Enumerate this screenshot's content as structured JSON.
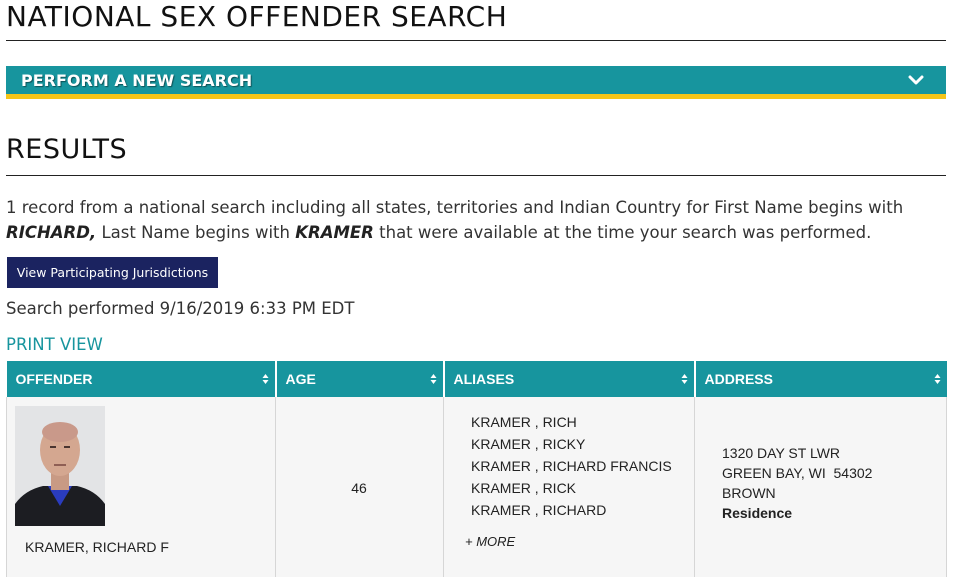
{
  "page": {
    "title": "NATIONAL SEX OFFENDER SEARCH"
  },
  "search_bar": {
    "label": "PERFORM A NEW SEARCH",
    "icon": "chevron-down-icon"
  },
  "results": {
    "heading": "RESULTS",
    "summary": {
      "part1": "1 record from a national search including all states, territories and Indian Country for First Name begins with ",
      "first_name": "RICHARD,",
      "part2": " Last Name begins with ",
      "last_name": "KRAMER",
      "part3": " that were available at the time your search was performed."
    },
    "jurisdictions_button": "View Participating Jurisdictions",
    "performed": "Search performed 9/16/2019 6:33 PM EDT",
    "print_view": "PRINT VIEW"
  },
  "table": {
    "columns": [
      "OFFENDER",
      "AGE",
      "ALIASES",
      "ADDRESS"
    ],
    "rows": [
      {
        "offender_name": "KRAMER, RICHARD F",
        "age": "46",
        "aliases": [
          "KRAMER , RICH",
          "KRAMER , RICKY",
          "KRAMER , RICHARD FRANCIS",
          "KRAMER , RICK",
          "KRAMER , RICHARD"
        ],
        "more_label": "+ MORE",
        "address": {
          "street": "1320 DAY ST LWR",
          "city_state_zip": "GREEN BAY, WI  54302",
          "county": "BROWN",
          "type": "Residence"
        }
      }
    ]
  },
  "colors": {
    "teal": "#17959e",
    "gold": "#f5c518",
    "navy": "#1b2360"
  }
}
